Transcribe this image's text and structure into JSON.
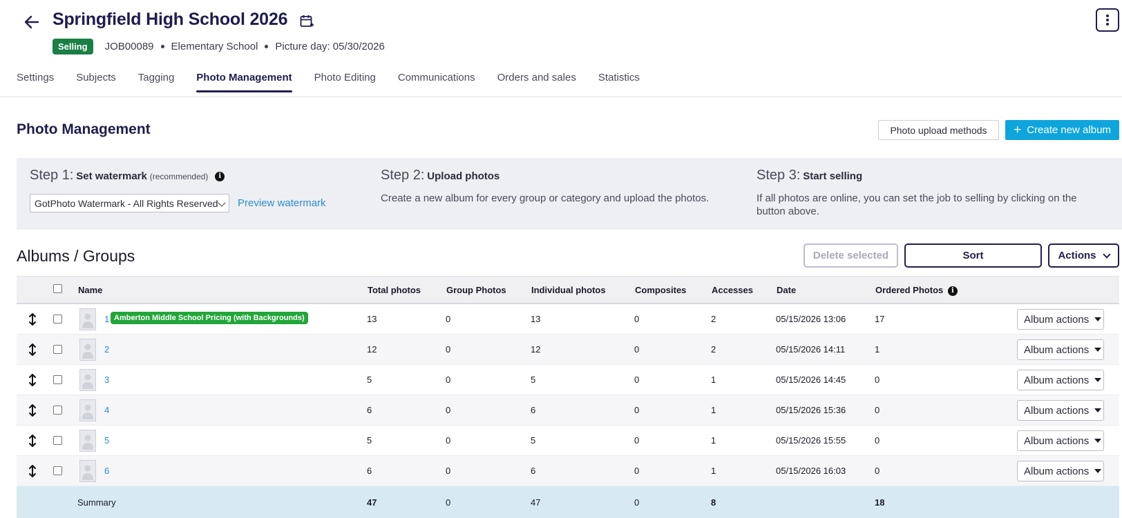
{
  "header": {
    "title": "Springfield High School 2026",
    "status": "Selling",
    "job_id": "JOB00089",
    "school_type": "Elementary School",
    "picture_day": "Picture day: 05/30/2026"
  },
  "tabs": [
    {
      "label": "Settings"
    },
    {
      "label": "Subjects"
    },
    {
      "label": "Tagging"
    },
    {
      "label": "Photo Management",
      "active": true
    },
    {
      "label": "Photo Editing"
    },
    {
      "label": "Communications"
    },
    {
      "label": "Orders and sales"
    },
    {
      "label": "Statistics"
    }
  ],
  "section": {
    "title": "Photo Management",
    "upload_methods_label": "Photo upload methods",
    "create_album_label": "Create new album"
  },
  "steps": {
    "step1": {
      "num": "Step 1:",
      "name": "Set watermark",
      "note": "(recommended)",
      "select_value": "GotPhoto Watermark - All Rights Reserved",
      "preview_label": "Preview watermark"
    },
    "step2": {
      "num": "Step 2:",
      "name": "Upload photos",
      "text": "Create a new album for every group or category and upload the photos."
    },
    "step3": {
      "num": "Step 3:",
      "name": "Start selling",
      "text": "If all photos are online, you can set the job to selling by clicking on the button above."
    }
  },
  "albums": {
    "title": "Albums / Groups",
    "delete_label": "Delete selected",
    "sort_label": "Sort",
    "actions_label": "Actions",
    "columns": [
      "Name",
      "Total photos",
      "Group Photos",
      "Individual photos",
      "Composites",
      "Accesses",
      "Date",
      "Ordered Photos"
    ],
    "rows": [
      {
        "name": "1",
        "badge": "Amberton Middle School Pricing (with Backgrounds)",
        "total": "13",
        "group": "0",
        "individual": "13",
        "composites": "0",
        "accesses": "2",
        "date": "05/15/2026 13:06",
        "ordered": "17"
      },
      {
        "name": "2",
        "total": "12",
        "group": "0",
        "individual": "12",
        "composites": "0",
        "accesses": "2",
        "date": "05/15/2026 14:11",
        "ordered": "1"
      },
      {
        "name": "3",
        "total": "5",
        "group": "0",
        "individual": "5",
        "composites": "0",
        "accesses": "1",
        "date": "05/15/2026 14:45",
        "ordered": "0"
      },
      {
        "name": "4",
        "total": "6",
        "group": "0",
        "individual": "6",
        "composites": "0",
        "accesses": "1",
        "date": "05/15/2026 15:36",
        "ordered": "0"
      },
      {
        "name": "5",
        "total": "5",
        "group": "0",
        "individual": "5",
        "composites": "0",
        "accesses": "1",
        "date": "05/15/2026 15:55",
        "ordered": "0"
      },
      {
        "name": "6",
        "total": "6",
        "group": "0",
        "individual": "6",
        "composites": "0",
        "accesses": "1",
        "date": "05/15/2026 16:03",
        "ordered": "0"
      }
    ],
    "album_actions_label": "Album actions",
    "summary": {
      "label": "Summary",
      "total": "47",
      "group": "0",
      "individual": "47",
      "composites": "0",
      "accesses": "8",
      "ordered": "18"
    }
  },
  "colors": {
    "brand_dark": "#1f1d4e",
    "selling_green": "#1a7f45",
    "primary_blue": "#0ea5dd",
    "link_blue": "#2a8ccf",
    "badge_green": "#22a63a",
    "summary_bg": "#d7eaf2"
  },
  "icons": [
    "back-arrow-icon",
    "calendar-add-icon",
    "more-vertical-icon",
    "plus-icon",
    "info-icon",
    "chevron-down-icon",
    "drag-handle-icon",
    "person-placeholder-icon",
    "caret-down-icon"
  ]
}
